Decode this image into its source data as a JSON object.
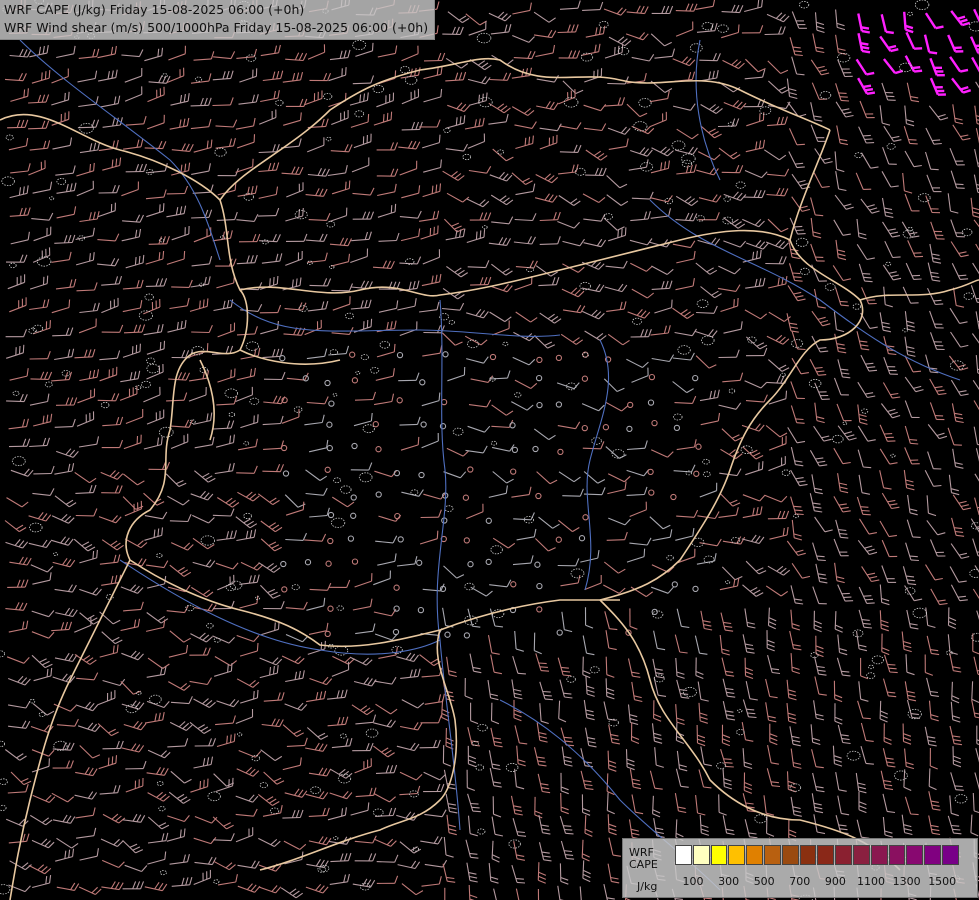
{
  "title": {
    "line1": "WRF CAPE (J/kg) Friday 15-08-2025 06:00 (+0h)",
    "line2": "WRF Wind shear (m/s) 500/1000hPa Friday 15-08-2025 06:00 (+0h)"
  },
  "legend": {
    "name_line1": "WRF",
    "name_line2": "CAPE",
    "units": "J/kg",
    "colors": [
      "#ffffff",
      "#ffffc0",
      "#ffff00",
      "#ffc000",
      "#e08000",
      "#b86010",
      "#9a4a10",
      "#8a3010",
      "#8a2818",
      "#8a2030",
      "#8a2040",
      "#8a1850",
      "#8a1060",
      "#880870",
      "#800080",
      "#780088"
    ],
    "ticks": [
      "100",
      "300",
      "500",
      "700",
      "900",
      "1100",
      "1300",
      "1500"
    ]
  },
  "colors": {
    "background": "#000000",
    "border": "#e8c8a0",
    "river": "#5070c0",
    "barb_red": "#c07070",
    "barb_grey": "#b8b0b8",
    "barb_magenta": "#ff20ff",
    "contour": "#d8d8d8"
  }
}
